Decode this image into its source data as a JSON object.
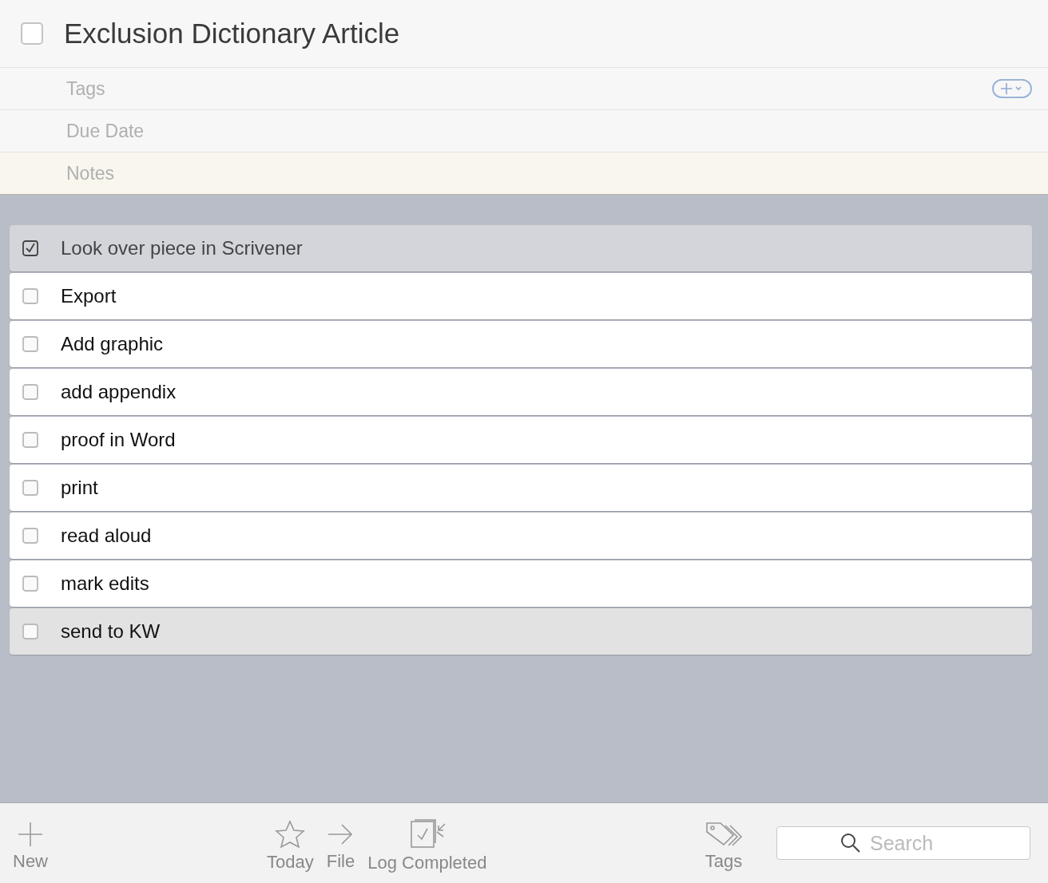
{
  "project": {
    "title": "Exclusion Dictionary Article",
    "checked": false
  },
  "fields": {
    "tags_placeholder": "Tags",
    "due_placeholder": "Due Date",
    "notes_placeholder": "Notes"
  },
  "items": [
    {
      "label": "Look over piece in Scrivener",
      "checked": true,
      "selected": false
    },
    {
      "label": "Export",
      "checked": false,
      "selected": false
    },
    {
      "label": "Add graphic",
      "checked": false,
      "selected": false
    },
    {
      "label": "add appendix",
      "checked": false,
      "selected": false
    },
    {
      "label": "proof in Word",
      "checked": false,
      "selected": false
    },
    {
      "label": "print",
      "checked": false,
      "selected": false
    },
    {
      "label": "read aloud",
      "checked": false,
      "selected": false
    },
    {
      "label": "mark edits",
      "checked": false,
      "selected": false
    },
    {
      "label": "send to KW",
      "checked": false,
      "selected": true
    }
  ],
  "toolbar": {
    "buttons": [
      {
        "kind": "new",
        "label": "New"
      },
      {
        "kind": "today",
        "label": "Today"
      },
      {
        "kind": "file",
        "label": "File"
      },
      {
        "kind": "log",
        "label": "Log Completed"
      },
      {
        "kind": "tags",
        "label": "Tags"
      }
    ],
    "search_placeholder": "Search"
  }
}
